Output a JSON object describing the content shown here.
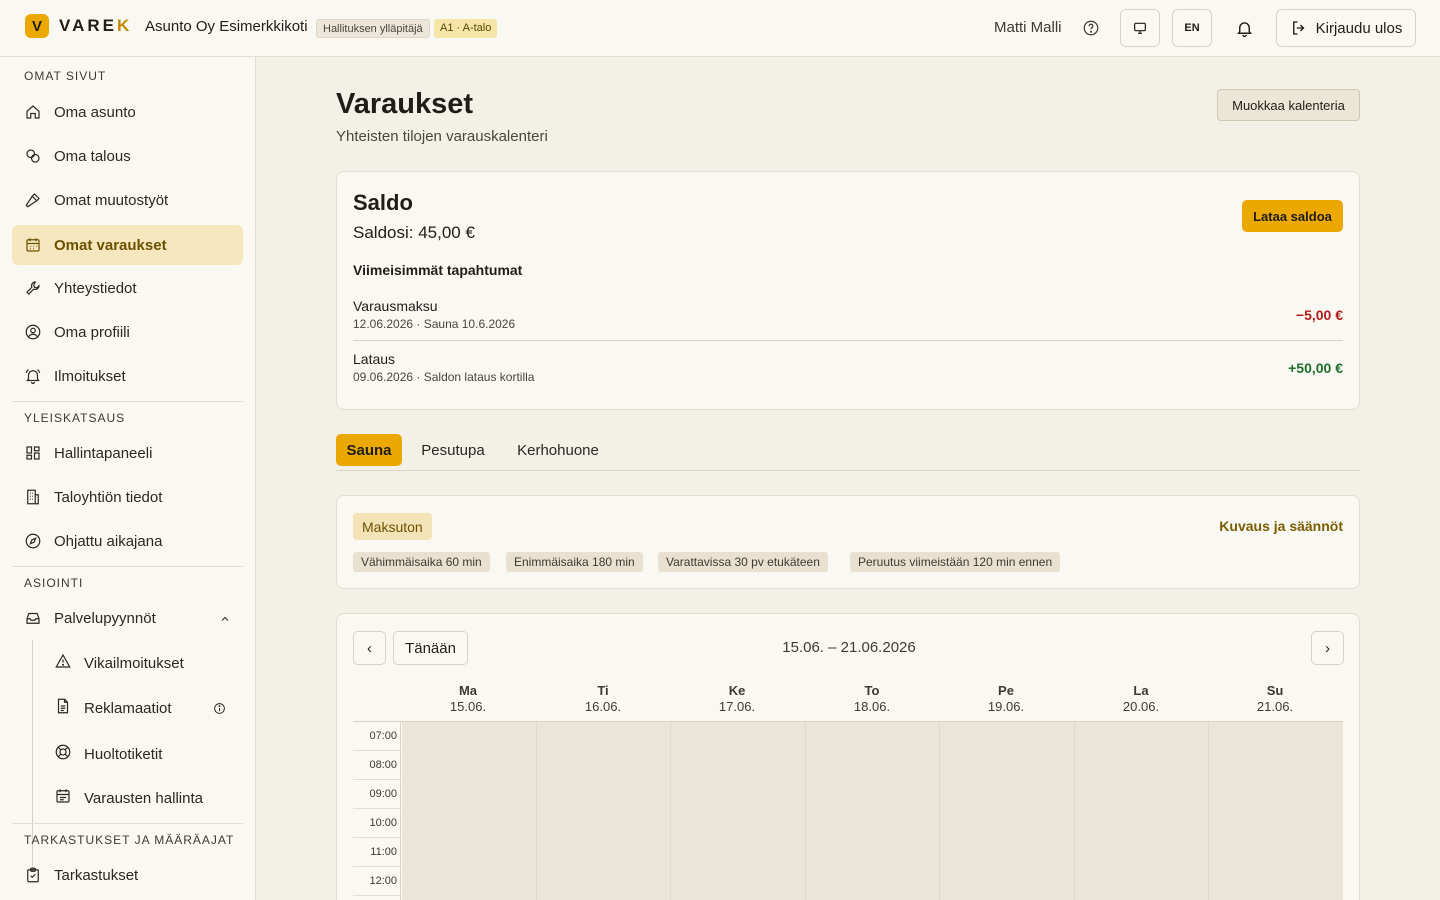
{
  "header": {
    "logo_mark": "V",
    "logo_text_main": "VARE",
    "logo_text_accent": "K",
    "org_name": "Asunto Oy Esimerkkikoti",
    "role_badge": "Hallituksen ylläpitäjä",
    "apartment_badge": "A1 · A-talo",
    "user_name": "Matti Malli",
    "lang_button": "EN",
    "logout_label": "Kirjaudu ulos"
  },
  "sidebar": {
    "sections": {
      "own": "OMAT SIVUT",
      "overview": "YLEISKATSAUS",
      "services": "ASIOINTI",
      "inspections": "TARKASTUKSET JA MÄÄRÄAJAT"
    },
    "own_items": [
      {
        "label": "Oma asunto",
        "icon": "home-icon"
      },
      {
        "label": "Oma talous",
        "icon": "coins-icon"
      },
      {
        "label": "Omat muutostyöt",
        "icon": "hammer-icon"
      },
      {
        "label": "Omat varaukset",
        "icon": "calendar-icon",
        "active": true
      },
      {
        "label": "Yhteystiedot",
        "icon": "wrench-icon"
      },
      {
        "label": "Oma profiili",
        "icon": "user-circle-icon"
      },
      {
        "label": "Ilmoitukset",
        "icon": "bell-icon"
      }
    ],
    "overview_items": [
      {
        "label": "Hallintapaneeli",
        "icon": "dashboard-icon"
      },
      {
        "label": "Taloyhtiön tiedot",
        "icon": "building-icon"
      },
      {
        "label": "Ohjattu aikajana",
        "icon": "compass-icon"
      }
    ],
    "service_group": {
      "label": "Palvelupyynnöt",
      "icon": "inbox-icon"
    },
    "service_items": [
      {
        "label": "Vikailmoitukset",
        "icon": "warning-icon"
      },
      {
        "label": "Reklamaatiot",
        "icon": "document-icon"
      },
      {
        "label": "Huoltotiketit",
        "icon": "lifebuoy-icon"
      },
      {
        "label": "Varausten hallinta",
        "icon": "calendar-list-icon"
      }
    ],
    "inspection_items": [
      {
        "label": "Tarkastukset",
        "icon": "clipboard-icon"
      }
    ]
  },
  "main": {
    "title": "Varaukset",
    "subtitle": "Yhteisten tilojen varauskalenteri",
    "edit_calendar_label": "Muokkaa kalenteria",
    "balance": {
      "title": "Saldo",
      "value": "Saldosi: 45,00 €",
      "load_label": "Lataa saldoa",
      "recent_title": "Viimeisimmät tapahtumat",
      "transactions": [
        {
          "name": "Varausmaksu",
          "meta": "12.06.2026 · Sauna 10.6.2026",
          "amount": "−5,00 €",
          "type": "neg"
        },
        {
          "name": "Lataus",
          "meta": "09.06.2026 · Saldon lataus kortilla",
          "amount": "+50,00 €",
          "type": "pos"
        }
      ]
    },
    "tabs": [
      {
        "label": "Sauna",
        "active": true
      },
      {
        "label": "Pesutupa",
        "active": false
      },
      {
        "label": "Kerhohuone",
        "active": false
      }
    ],
    "rules": {
      "price_pill": "Maksuton",
      "rules_link": "Kuvaus ja säännöt",
      "tags": [
        "Vähimmäisaika 60 min",
        "Enimmäisaika 180 min",
        "Varattavissa 30 pv etukäteen",
        "Peruutus viimeistään 120 min ennen"
      ]
    },
    "calendar": {
      "prev_label": "‹",
      "today_label": "Tänään",
      "next_label": "›",
      "range": "15.06. – 21.06.2026",
      "days": [
        {
          "name": "Ma",
          "date": "15.06."
        },
        {
          "name": "Ti",
          "date": "16.06."
        },
        {
          "name": "Ke",
          "date": "17.06."
        },
        {
          "name": "To",
          "date": "18.06."
        },
        {
          "name": "Pe",
          "date": "19.06."
        },
        {
          "name": "La",
          "date": "20.06."
        },
        {
          "name": "Su",
          "date": "21.06."
        }
      ],
      "times": [
        "07:00",
        "08:00",
        "09:00",
        "10:00",
        "11:00",
        "12:00"
      ]
    }
  },
  "colors": {
    "accent": "#eba800",
    "active_nav_bg": "#f6e7bf",
    "negative": "#b11c1c",
    "positive": "#1f6d2a"
  }
}
